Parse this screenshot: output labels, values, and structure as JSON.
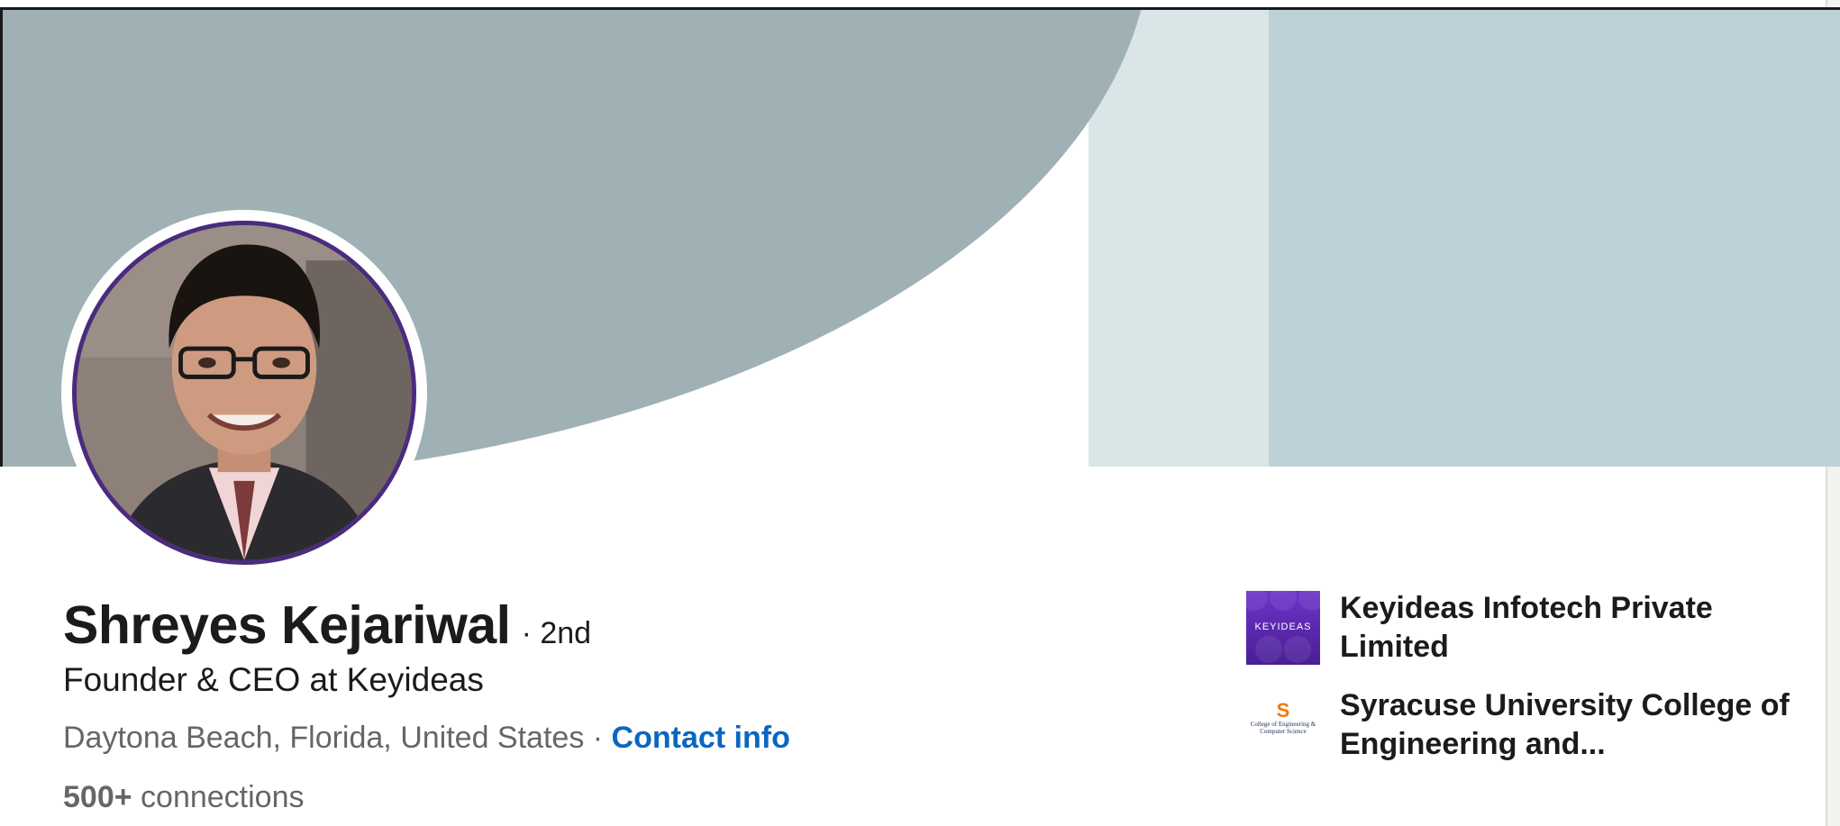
{
  "profile": {
    "name": "Shreyes Kejariwal",
    "degree": "· 2nd",
    "headline": "Founder & CEO at Keyideas",
    "location": "Daytona Beach, Florida, United States",
    "separator": " · ",
    "contact_info_label": "Contact info",
    "connections_count": "500+",
    "connections_label": " connections"
  },
  "affiliations": [
    {
      "name": "Keyideas Infotech Private Limited",
      "logo_text": "KEYIDEAS",
      "logo_icon": "keyideas-logo"
    },
    {
      "name": "Syracuse University College of Engineering and...",
      "logo_letter": "S",
      "logo_sub": "College of Engineering & Computer Science",
      "logo_icon": "syracuse-logo"
    }
  ],
  "colors": {
    "link": "#0a66c2",
    "cover_main": "#9fb1b5",
    "cover_light": "#d9e5e7",
    "cover_right": "#bed1d6",
    "avatar_ring": "#4a2b7e"
  }
}
